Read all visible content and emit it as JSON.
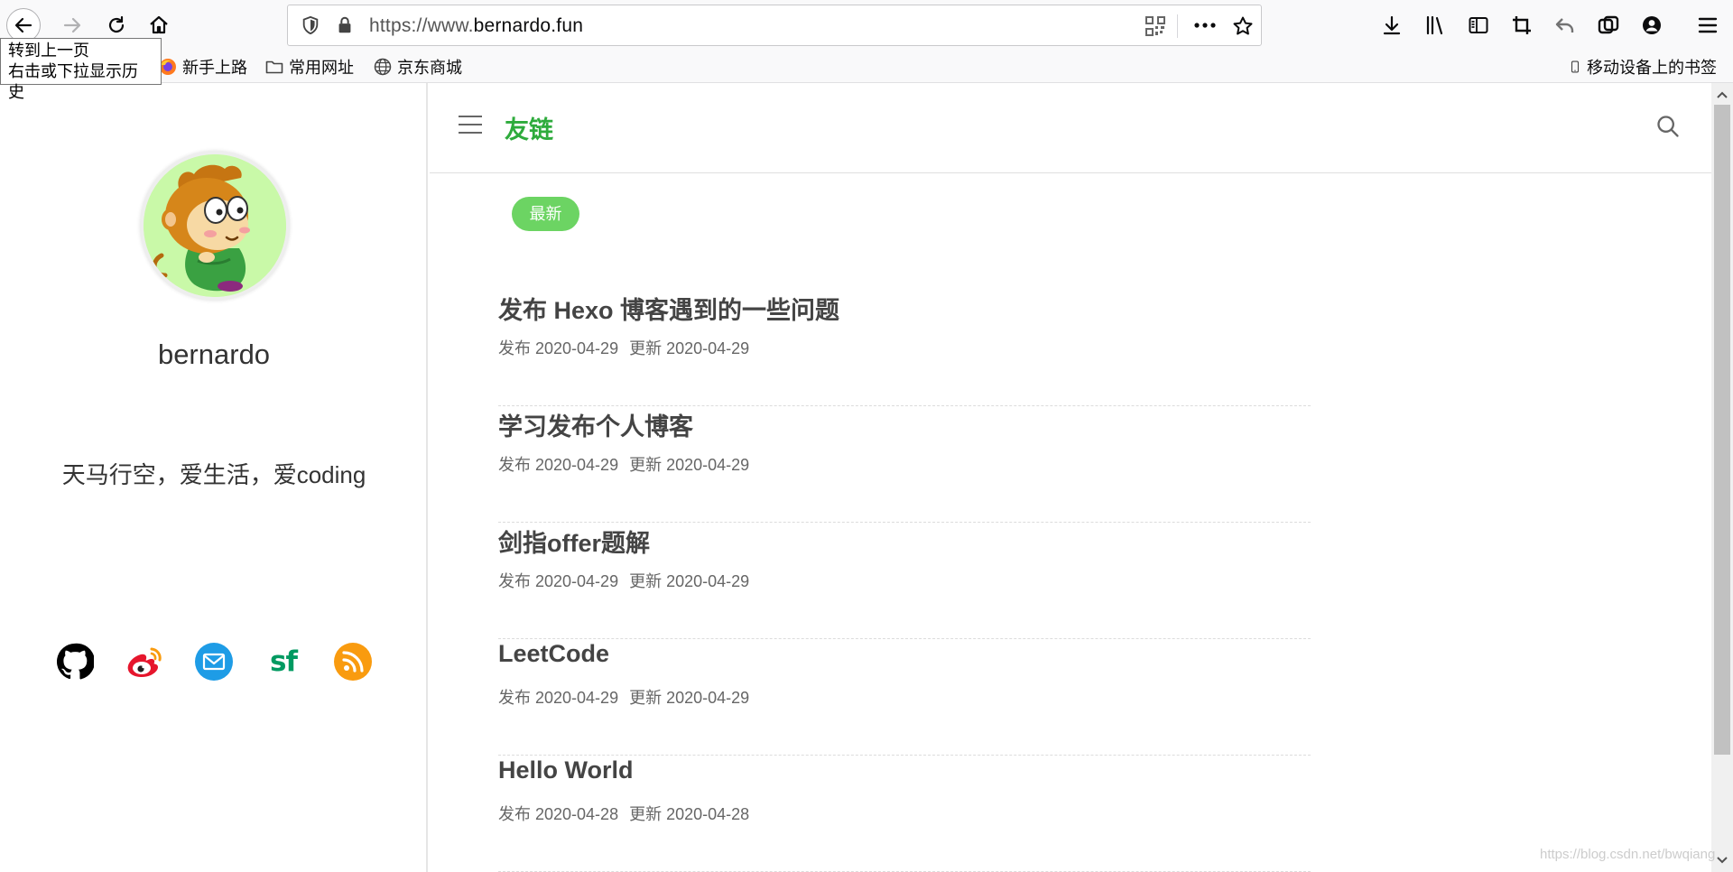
{
  "browser": {
    "url_prefix": "https://www.",
    "url_domain": "bernardo.fun",
    "tooltip_line1": "转到上一页",
    "tooltip_line2": "右击或下拉显示历史"
  },
  "bookmarks": {
    "items": [
      {
        "label": "新手上路",
        "icon": "firefox-icon"
      },
      {
        "label": "常用网址",
        "icon": "folder-icon"
      },
      {
        "label": "京东商城",
        "icon": "globe-icon"
      }
    ],
    "mobile": "移动设备上的书签"
  },
  "sidebar": {
    "username": "bernardo",
    "motto": "天马行空，爱生活，爱coding",
    "social": [
      {
        "name": "github-icon",
        "color": "#000000"
      },
      {
        "name": "weibo-icon",
        "color": "#e6162d"
      },
      {
        "name": "mail-icon",
        "color": "#1e9ce6"
      },
      {
        "name": "segmentfault-icon",
        "color": "#009a61",
        "text": "sf"
      },
      {
        "name": "rss-icon",
        "color": "#f99b0f"
      }
    ]
  },
  "main": {
    "title": "友链",
    "tag": "最新",
    "posts": [
      {
        "title": "发布 Hexo 博客遇到的一些问题",
        "published": "发布 2020-04-29",
        "updated": "更新 2020-04-29"
      },
      {
        "title": "学习发布个人博客",
        "published": "发布 2020-04-29",
        "updated": "更新 2020-04-29"
      },
      {
        "title": "剑指offer题解",
        "published": "发布 2020-04-29",
        "updated": "更新 2020-04-29"
      },
      {
        "title": "LeetCode",
        "published": "发布 2020-04-29",
        "updated": "更新 2020-04-29"
      },
      {
        "title": "Hello World",
        "published": "发布 2020-04-28",
        "updated": "更新 2020-04-28"
      }
    ]
  },
  "watermark": "https://blog.csdn.net/bwqiang",
  "colors": {
    "accent_green": "#2eab3c",
    "tag_green": "#6cd463"
  }
}
